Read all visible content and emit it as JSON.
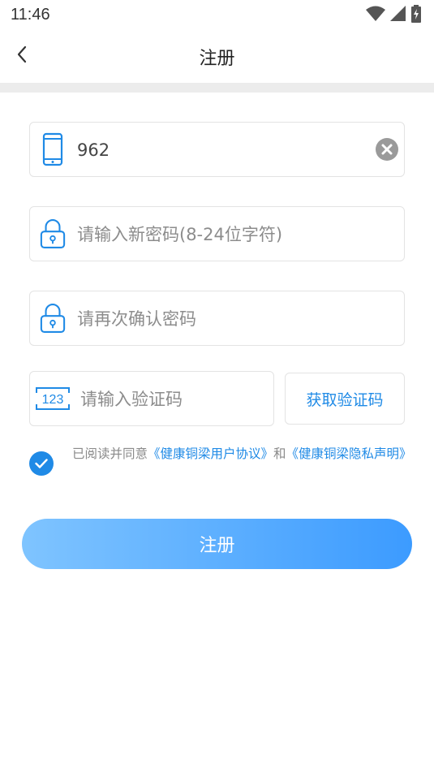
{
  "status_bar": {
    "time": "11:46",
    "icons": [
      "wifi-icon",
      "signal-icon",
      "battery-charging-icon"
    ]
  },
  "app_bar": {
    "title": "注册",
    "back_icon": "chevron-left-icon"
  },
  "form": {
    "phone": {
      "value": "962",
      "placeholder": "",
      "icon": "phone-icon",
      "clear_icon": "clear-icon"
    },
    "password": {
      "value": "",
      "placeholder": "请输入新密码(8-24位字符)",
      "icon": "lock-icon"
    },
    "confirm_password": {
      "value": "",
      "placeholder": "请再次确认密码",
      "icon": "lock-icon"
    },
    "verification_code": {
      "value": "",
      "placeholder": "请输入验证码",
      "icon": "code-123-icon",
      "icon_text": "123"
    },
    "get_code_label": "获取验证码"
  },
  "agreement": {
    "checked": true,
    "prefix": "已阅读并同意",
    "link1": "《健康铜梁用户协议》",
    "middle": "和",
    "link2": "《健康铜梁隐私声明》"
  },
  "submit_label": "注册",
  "colors": {
    "accent": "#1f8ae6",
    "button_gradient_start": "#7fc4ff",
    "button_gradient_end": "#3c9bff",
    "divider": "#ececec"
  }
}
